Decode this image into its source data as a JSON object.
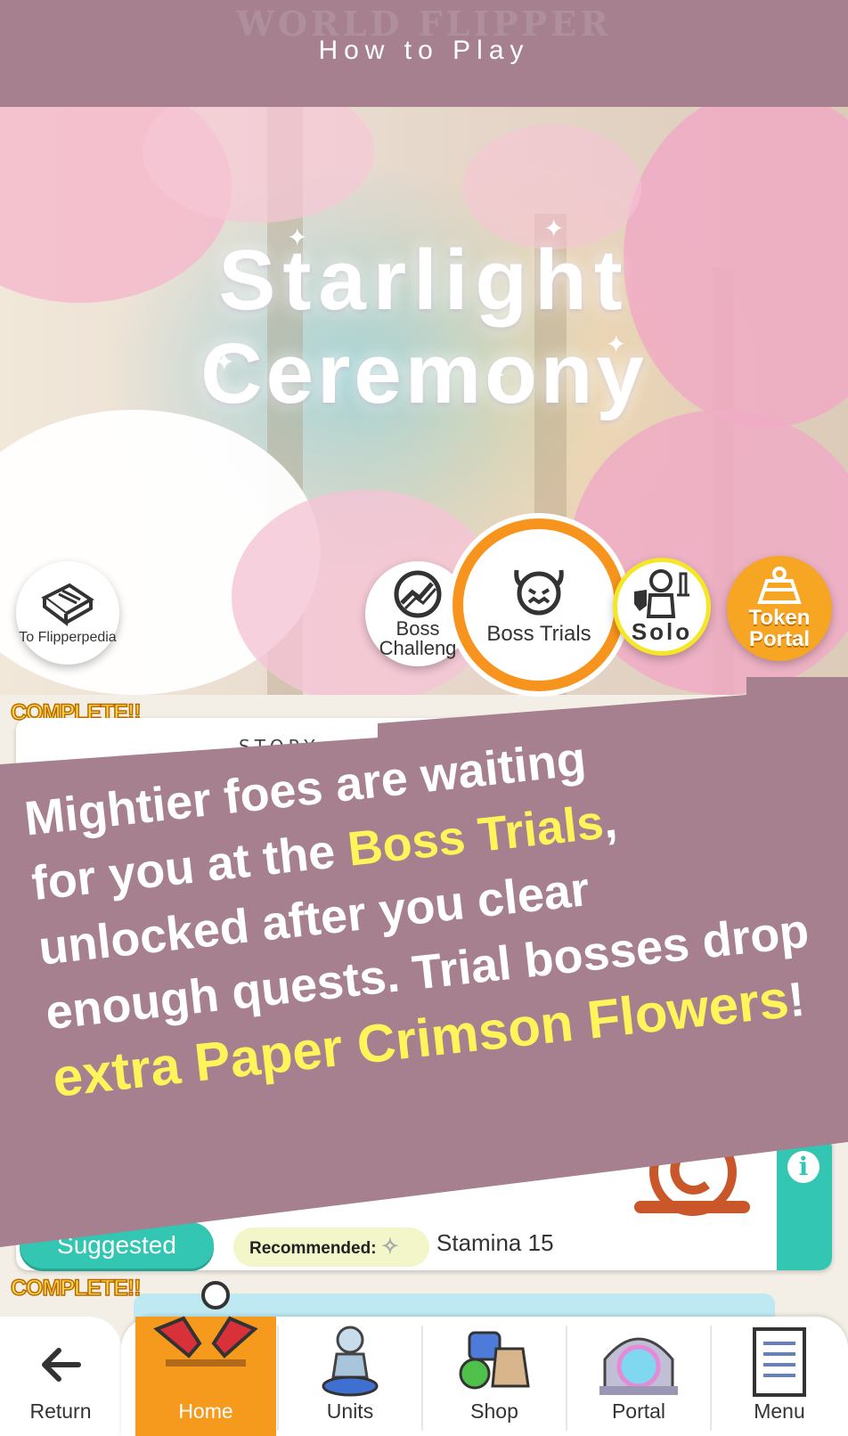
{
  "header": {
    "title": "How to Play",
    "watermark": "WORLD FLIPPER"
  },
  "logo": {
    "line1": "Starlight",
    "line2": "Ceremony"
  },
  "mode_buttons": {
    "flipperpedia": "To Flipperpedia",
    "boss_challenge": "Boss Challeng",
    "boss_trials": "Boss Trials",
    "solo": "Solo",
    "token_portal": "Token Portal"
  },
  "quest_list": {
    "complete_label_1": "COMPLETE!!",
    "story_label": "STORY",
    "suggested": "Suggested",
    "recommended": "Recommended:",
    "stamina": "Stamina 15",
    "complete_label_2": "COMPLETE!!"
  },
  "banner": {
    "line1": "Mightier foes are waiting",
    "line2_a": "for you at the ",
    "line2_hl": "Boss Trials",
    "line2_b": ",",
    "line3": "unlocked after you clear",
    "line4": "enough quests. Trial bosses drop",
    "line5_hl": "extra Paper Crimson Flowers",
    "line5_b": "!"
  },
  "nav": {
    "return": "Return",
    "home": "Home",
    "units": "Units",
    "shop": "Shop",
    "portal": "Portal",
    "menu": "Menu"
  },
  "colors": {
    "header_bg": "#a6808f",
    "highlight": "#fff55a",
    "accent_orange": "#f7941d",
    "teal": "#33c6b3"
  }
}
